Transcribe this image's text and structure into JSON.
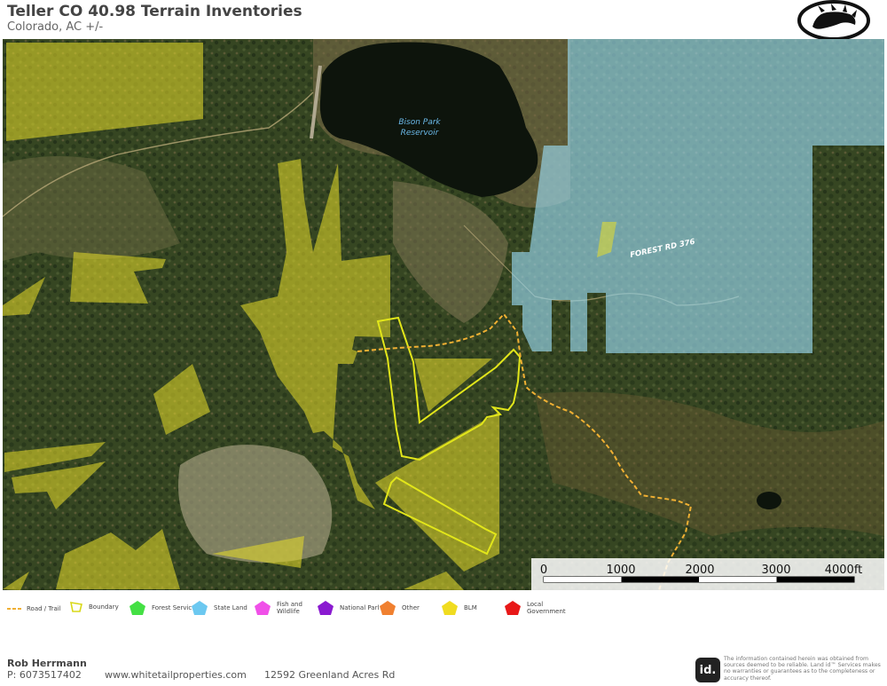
{
  "header": {
    "title": "Teller CO 40.98 Terrain Inventories",
    "subtitle": "Colorado,  AC +/-",
    "logo_icon": "paw-print-icon"
  },
  "map": {
    "labels": {
      "reservoir": "Bison Park",
      "reservoir_line2": "Reservoir",
      "road": "FOREST RD 376"
    },
    "scale_bar": {
      "ticks": [
        "0",
        "1000",
        "2000",
        "3000",
        "4000ft"
      ]
    },
    "colors": {
      "blm": "#e8de2a",
      "state_land": "#9ad8f0",
      "boundary": "#e2e61a",
      "road_trail": "#f0b033",
      "water": "#0d140c"
    }
  },
  "legend": {
    "items": [
      {
        "label": "Road / Trail",
        "icon": "dashed-line-icon",
        "color": "#f0b033"
      },
      {
        "label": "Boundary",
        "icon": "boundary-outline-icon",
        "color": "#d8d818"
      },
      {
        "label": "Forest Servic",
        "icon": "pentagon-icon",
        "color": "#44e044"
      },
      {
        "label": "State Land",
        "icon": "pentagon-icon",
        "color": "#6cc8f0"
      },
      {
        "label": "Fish and Wildlife",
        "icon": "pentagon-icon",
        "color": "#f050e8"
      },
      {
        "label": "National Parl",
        "icon": "pentagon-icon",
        "color": "#8a1ad0"
      },
      {
        "label": "Other",
        "icon": "pentagon-icon",
        "color": "#f08030"
      },
      {
        "label": "BLM",
        "icon": "pentagon-icon",
        "color": "#f0dc20"
      },
      {
        "label": "Local Government",
        "icon": "pentagon-icon",
        "color": "#e81818"
      }
    ]
  },
  "footer": {
    "agent_name": "Rob Herrmann",
    "phone": "P: 6073517402",
    "website": "www.whitetailproperties.com",
    "address": "12592 Greenland Acres Rd",
    "id_logo": "id.",
    "disclaimer": "The information contained herein was obtained from sources deemed to be reliable. Land id™ Services makes no warranties or guarantees as to the completeness or accuracy thereof."
  }
}
